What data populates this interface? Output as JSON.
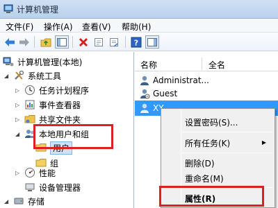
{
  "window": {
    "title": "计算机管理"
  },
  "menu": {
    "file": "文件(F)",
    "action": "操作(A)",
    "view": "查看(V)",
    "help": "帮助(H)"
  },
  "toolbar": {
    "icons": [
      "back-arrow-icon",
      "forward-arrow-icon",
      "up-folder-icon",
      "show-hide-tree-icon",
      "delete-icon",
      "properties-icon",
      "export-icon",
      "help-icon",
      "show-action-pane-icon"
    ]
  },
  "tree": {
    "root": "计算机管理(本地)",
    "system_tools": "系统工具",
    "task_scheduler": "任务计划程序",
    "event_viewer": "事件查看器",
    "shared_folders": "共享文件夹",
    "local_users_groups": "本地用户和组",
    "users": "用户",
    "groups": "组",
    "performance": "性能",
    "device_manager": "设备管理器",
    "storage": "存储"
  },
  "list": {
    "headers": {
      "name": "名称",
      "full_name": "全名"
    },
    "users": [
      "Administrat...",
      "Guest",
      "XY"
    ]
  },
  "context_menu": {
    "set_password": "设置密码(S)...",
    "all_tasks": "所有任务(K)",
    "delete": "删除(D)",
    "rename": "重命名(M)",
    "properties": "属性(R)"
  },
  "colors": {
    "selection": "#3399ff",
    "highlight_box": "#e02020"
  }
}
